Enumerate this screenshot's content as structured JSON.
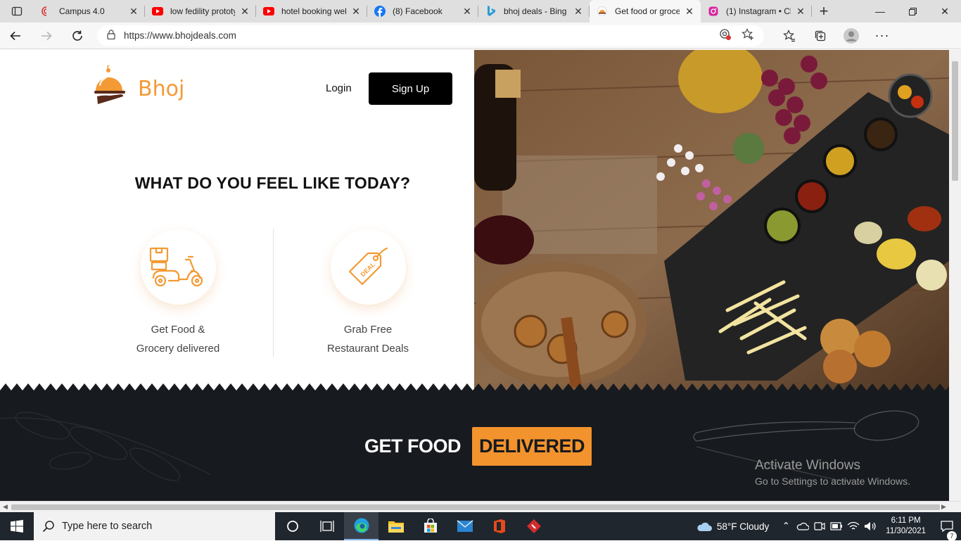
{
  "browser": {
    "tabs": [
      {
        "title": "Campus 4.0",
        "icon": "campus-icon",
        "active": false
      },
      {
        "title": "low fedility prototy",
        "icon": "youtube-icon",
        "active": false
      },
      {
        "title": "hotel booking web",
        "icon": "youtube-icon",
        "active": false
      },
      {
        "title": "(8) Facebook",
        "icon": "facebook-icon",
        "active": false
      },
      {
        "title": "bhoj deals - Bing",
        "icon": "bing-icon",
        "active": false
      },
      {
        "title": "Get food or groce",
        "icon": "bhoj-icon",
        "active": true
      },
      {
        "title": "(1) Instagram • Ch",
        "icon": "instagram-icon",
        "active": false
      }
    ],
    "new_tab": "+",
    "url": "https://www.bhojdeals.com"
  },
  "page": {
    "brand": "Bhoj",
    "login": "Login",
    "signup": "Sign Up",
    "headline": "WHAT DO YOU FEEL LIKE TODAY?",
    "options": [
      {
        "line1": "Get Food &",
        "line2": "Grocery delivered",
        "icon": "delivery-scooter-icon"
      },
      {
        "line1": "Grab Free",
        "line2": "Restaurant Deals",
        "icon": "deal-tag-icon"
      }
    ],
    "deal_tag_text": "DEAL",
    "band_text_1": "GET FOOD",
    "band_text_2": "DELIVERED",
    "colors": {
      "accent": "#f3932d",
      "dark": "#171a1e"
    }
  },
  "watermark": {
    "line1": "Activate Windows",
    "line2": "Go to Settings to activate Windows."
  },
  "taskbar": {
    "search_placeholder": "Type here to search",
    "weather": "58°F  Cloudy",
    "time": "6:11 PM",
    "date": "11/30/2021",
    "notifications": "7"
  }
}
